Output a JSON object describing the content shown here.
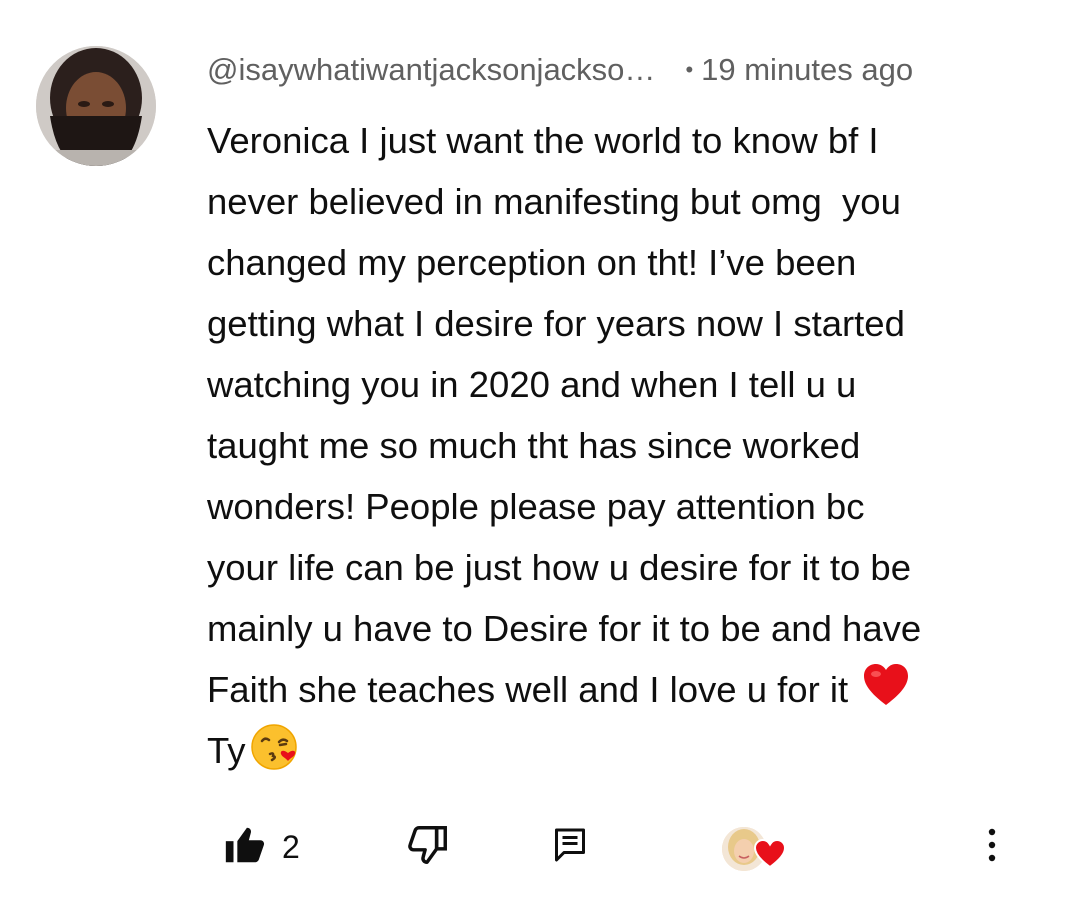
{
  "comment": {
    "author_handle": "@isaywhatiwantjacksonjackso…",
    "separator": "•",
    "timestamp": "19 minutes ago",
    "body_lines": [
      "Veronica I just want the world to know bf I",
      "never believed in manifesting but omg  you",
      "changed my perception on tht! I’ve been",
      "getting what I desire for years now I started",
      "watching you in 2020 and when I tell u u",
      "taught me so much tht has since worked",
      "wonders! People please pay attention bc",
      "your life can be just how u desire for it to be",
      "mainly u have to Desire for it to be and have",
      "Faith she teaches well and I love u for it "
    ],
    "last_line": "Ty",
    "inline_emojis": [
      "red-heart-emoji",
      "face-blowing-kiss-emoji"
    ]
  },
  "actions": {
    "like_icon": "thumbs-up-filled-icon",
    "like_count": "2",
    "dislike_icon": "thumbs-down-outline-icon",
    "reply_icon": "reply-comment-icon",
    "creator_heart_icon": "creator-heart-icon",
    "more_icon": "more-vertical-icon"
  },
  "colors": {
    "background": "#ffffff",
    "text_primary": "#0f0f0f",
    "text_secondary": "#606060",
    "heart_red": "#e8101a"
  }
}
